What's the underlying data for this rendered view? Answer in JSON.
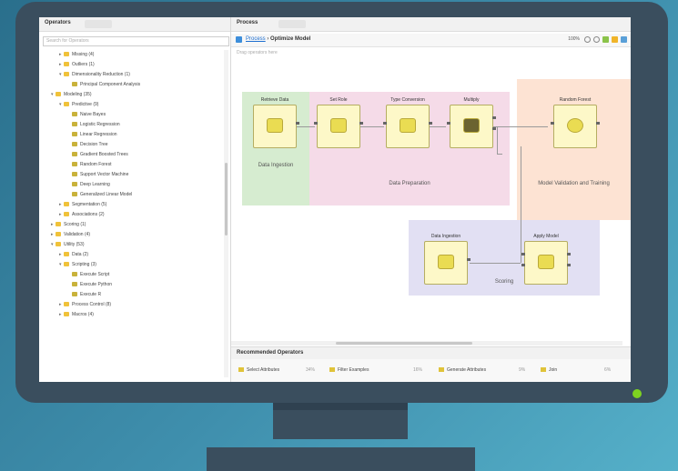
{
  "colors": {
    "background_gradient": [
      "#2a6f8c",
      "#55b0c9"
    ],
    "monitor": "#3a4e5e",
    "power_led": "#7ed321",
    "region_retrieve": "#d6ecd0",
    "region_preprocess": "#f5dbe8",
    "region_model": "#fde3d3",
    "region_scoring": "#e2e0f3",
    "operator_fill": "#fdf8c8"
  },
  "operators_panel": {
    "title": "Operators",
    "search_placeholder": "Search for Operators",
    "tree": [
      {
        "label": "Missing (4)",
        "depth": 2,
        "kind": "folder",
        "expanded": false
      },
      {
        "label": "Outliers (1)",
        "depth": 2,
        "kind": "folder",
        "expanded": false
      },
      {
        "label": "Dimensionality Reduction (1)",
        "depth": 2,
        "kind": "folder",
        "expanded": true
      },
      {
        "label": "Principal Component Analysis",
        "depth": 3,
        "kind": "operator"
      },
      {
        "label": "Modeling (35)",
        "depth": 1,
        "kind": "folder",
        "expanded": true
      },
      {
        "label": "Predictive (9)",
        "depth": 2,
        "kind": "folder",
        "expanded": true
      },
      {
        "label": "Naive Bayes",
        "depth": 3,
        "kind": "operator"
      },
      {
        "label": "Logistic Regression",
        "depth": 3,
        "kind": "operator"
      },
      {
        "label": "Linear Regression",
        "depth": 3,
        "kind": "operator"
      },
      {
        "label": "Decision Tree",
        "depth": 3,
        "kind": "operator"
      },
      {
        "label": "Gradient Boosted Trees",
        "depth": 3,
        "kind": "operator"
      },
      {
        "label": "Random Forest",
        "depth": 3,
        "kind": "operator"
      },
      {
        "label": "Support Vector Machine",
        "depth": 3,
        "kind": "operator"
      },
      {
        "label": "Deep Learning",
        "depth": 3,
        "kind": "operator"
      },
      {
        "label": "Generalized Linear Model",
        "depth": 3,
        "kind": "operator"
      },
      {
        "label": "Segmentation (5)",
        "depth": 2,
        "kind": "folder",
        "expanded": false
      },
      {
        "label": "Associations (2)",
        "depth": 2,
        "kind": "folder",
        "expanded": false
      },
      {
        "label": "Scoring (1)",
        "depth": 1,
        "kind": "folder",
        "expanded": false
      },
      {
        "label": "Validation (4)",
        "depth": 1,
        "kind": "folder",
        "expanded": false
      },
      {
        "label": "Utility (53)",
        "depth": 1,
        "kind": "folder",
        "expanded": true
      },
      {
        "label": "Data (2)",
        "depth": 2,
        "kind": "folder",
        "expanded": false
      },
      {
        "label": "Scripting (3)",
        "depth": 2,
        "kind": "folder",
        "expanded": true
      },
      {
        "label": "Execute Script",
        "depth": 3,
        "kind": "operator"
      },
      {
        "label": "Execute Python",
        "depth": 3,
        "kind": "operator"
      },
      {
        "label": "Execute R",
        "depth": 3,
        "kind": "operator"
      },
      {
        "label": "Process Control (8)",
        "depth": 2,
        "kind": "folder",
        "expanded": false
      },
      {
        "label": "Macros (4)",
        "depth": 2,
        "kind": "folder",
        "expanded": false
      }
    ]
  },
  "process_panel": {
    "title": "Process",
    "breadcrumb_root": "Process",
    "breadcrumb_sep": "›",
    "breadcrumb_current": "Optimize Model",
    "zoom": "100%",
    "canvas_hint": "Drag operators here",
    "regions": [
      {
        "label": "Data Ingestion"
      },
      {
        "label": "Data Preparation"
      },
      {
        "label": "Model Validation and Training"
      },
      {
        "label": "Scoring"
      }
    ],
    "operators": [
      {
        "title": "Retrieve Data"
      },
      {
        "title": "Set Role"
      },
      {
        "title": "Type Conversion"
      },
      {
        "title": "Multiply"
      },
      {
        "title": "Random Forest"
      },
      {
        "title": "Data Ingestion"
      },
      {
        "title": "Apply Model"
      }
    ]
  },
  "recommended": {
    "title": "Recommended Operators",
    "items": [
      {
        "label": "Select Attributes",
        "pct": "34%"
      },
      {
        "label": "Filter Examples",
        "pct": "16%"
      },
      {
        "label": "Generate Attributes",
        "pct": "9%"
      },
      {
        "label": "Join",
        "pct": "6%"
      }
    ]
  }
}
